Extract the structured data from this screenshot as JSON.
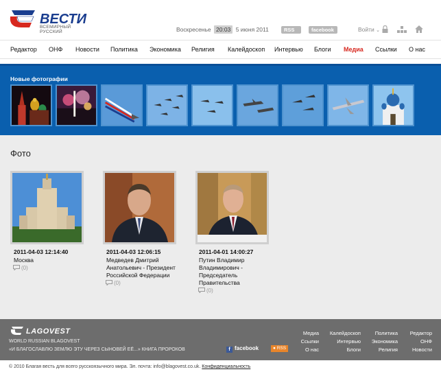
{
  "header": {
    "logo_title": "ВЕСТИ",
    "logo_sub": "ВСЕМИРНЫЙ РУССКИЙ",
    "weekday": "Воскресенье",
    "time": "20:03",
    "date": "5 июня 2011",
    "rss_label": "RSS",
    "facebook_label": "facebook",
    "login_label": "Войти"
  },
  "nav": {
    "items": [
      {
        "label": "Редактор"
      },
      {
        "label": "ОНФ"
      },
      {
        "label": "Новости"
      },
      {
        "label": "Политика"
      },
      {
        "label": "Экономика"
      },
      {
        "label": "Религия"
      },
      {
        "label": "Калейдоскоп"
      },
      {
        "label": "Интервью"
      },
      {
        "label": "Блоги"
      },
      {
        "label": "Медиа"
      },
      {
        "label": "Ссылки"
      },
      {
        "label": "О нас"
      }
    ],
    "active": "Медиа"
  },
  "gallery": {
    "title": "Новые фотографии"
  },
  "main": {
    "section_title": "Фото",
    "cards": [
      {
        "date": "2011-04-03 12:14:40",
        "caption": "Москва",
        "comments": "(0)"
      },
      {
        "date": "2011-04-03 12:06:15",
        "caption": "Медведев Дмитрий Анатольевич - Президент Российской Федерации",
        "comments": "(0)"
      },
      {
        "date": "2011-04-01 14:00:27",
        "caption": "Путин Владимир Владимирович - Председатель Правительства",
        "comments": "(0)"
      }
    ]
  },
  "footer": {
    "logo": "LAGOVEST",
    "sub": "WORLD RUSSIAN BLAGOVEST",
    "quote": "«И БЛАГОСЛАВЛЮ ЗЕМЛЮ ЭТУ ЧЕРЕЗ СЫНОВЕЙ ЕЁ...» КНИГА ПРОРОКОВ",
    "facebook_label": "facebook",
    "rss_label": "RSS",
    "links": [
      [
        "Медиа",
        "Калейдоскоп",
        "Политика",
        "Редактор"
      ],
      [
        "Ссылки",
        "Интервью",
        "Экономика",
        "ОНФ"
      ],
      [
        "О нас",
        "Блоги",
        "Религия",
        "Новости"
      ]
    ]
  },
  "copyright": {
    "text": "© 2010 Благая весть для всего русскоязычного мира. Эл. почта: info@blagovest.co.uk.",
    "privacy": "Конфиденциальность"
  },
  "colors": {
    "brand_blue": "#0a5fae",
    "active_red": "#d7281f",
    "footer_gray": "#6d6d6d"
  }
}
